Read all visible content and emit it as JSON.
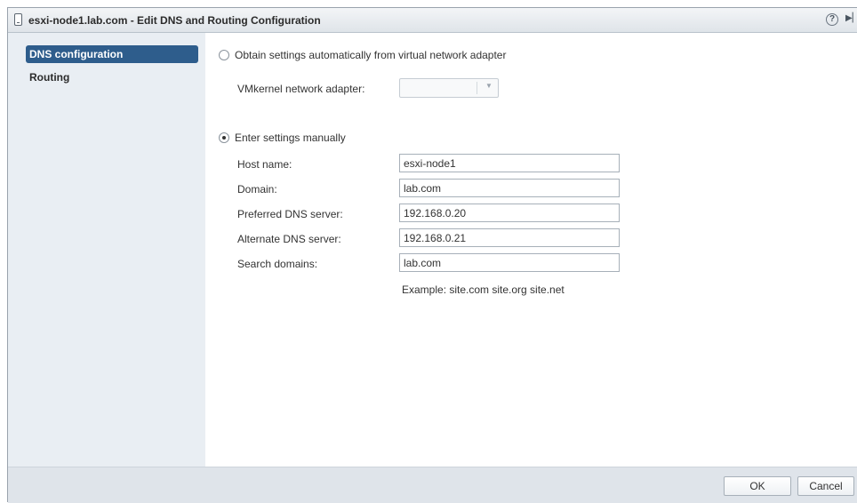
{
  "window": {
    "title": "esxi-node1.lab.com - Edit DNS and Routing Configuration",
    "help_glyph": "?",
    "expand_glyph": "▶▏",
    "icons": [
      "document-icon",
      "help-icon",
      "expand-icon"
    ]
  },
  "sidebar": {
    "items": [
      {
        "label": "DNS configuration",
        "selected": true
      },
      {
        "label": "Routing",
        "selected": false
      }
    ]
  },
  "dns": {
    "auto_option": {
      "label": "Obtain settings automatically from virtual network adapter",
      "checked": false
    },
    "vmkernel_label": "VMkernel network adapter:",
    "vmkernel_value": "",
    "select_chevron": "▼",
    "manual_option": {
      "label": "Enter settings manually",
      "checked": true
    },
    "fields": {
      "host_name": {
        "label": "Host name:",
        "value": "esxi-node1"
      },
      "domain": {
        "label": "Domain:",
        "value": "lab.com"
      },
      "preferred_dns": {
        "label": "Preferred DNS server:",
        "value": "192.168.0.20"
      },
      "alternate_dns": {
        "label": "Alternate DNS server:",
        "value": "192.168.0.21"
      },
      "search_domains": {
        "label": "Search domains:",
        "value": "lab.com"
      }
    },
    "example": "Example: site.com site.org site.net"
  },
  "footer": {
    "ok_label": "OK",
    "cancel_label": "Cancel"
  },
  "colors": {
    "selected_item_bg": "#2e5d8c",
    "sidebar_bg": "#e9eef3",
    "footer_bg": "#dfe4ea"
  }
}
